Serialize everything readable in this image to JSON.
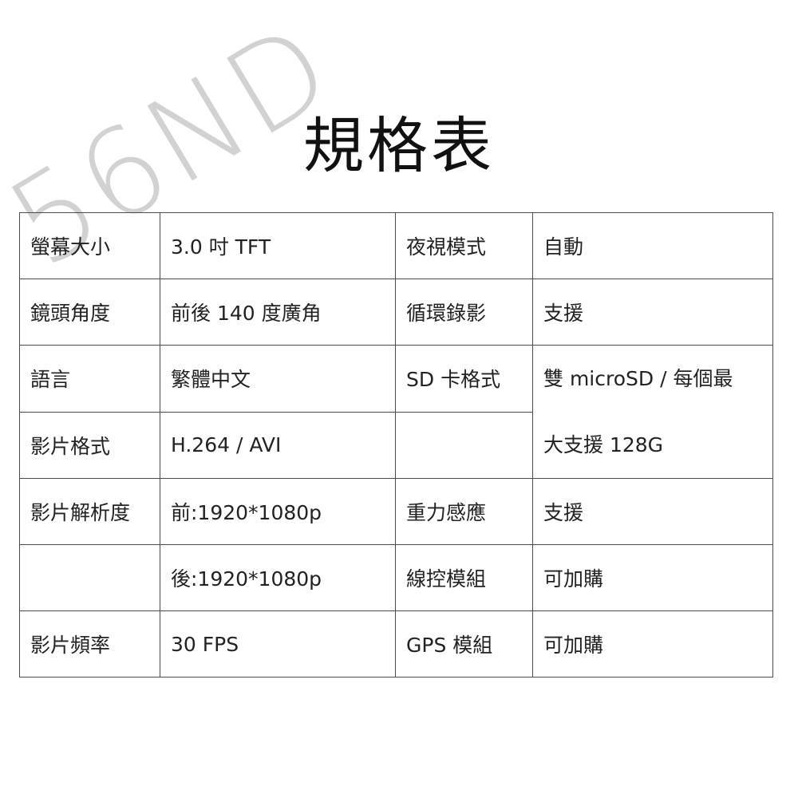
{
  "watermark": "56ND",
  "title": "規格表",
  "table": {
    "rows": [
      [
        "螢幕大小",
        "3.0 吋  TFT",
        "夜視模式",
        "自動"
      ],
      [
        "鏡頭角度",
        "前後 140 度廣角",
        "循環錄影",
        "支援"
      ],
      [
        "語言",
        "繁體中文",
        "SD 卡格式"
      ],
      [
        "影片格式",
        "H.264 / AVI",
        ""
      ],
      [
        "影片解析度",
        "前:1920*1080p",
        "重力感應",
        "支援"
      ],
      [
        "",
        "後:1920*1080p",
        "線控模組",
        "可加購"
      ],
      [
        "影片頻率",
        "30 FPS",
        "GPS 模組",
        "可加購"
      ]
    ],
    "sd_value_line1": "雙 microSD /  每個最",
    "sd_value_line2": "大支援 128G"
  }
}
